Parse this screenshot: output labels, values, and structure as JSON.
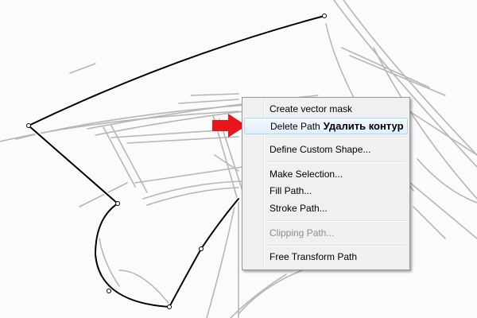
{
  "context_menu": {
    "items": [
      {
        "label": "Create vector mask",
        "state": "normal"
      },
      {
        "label": "Delete Path",
        "annotation": "Удалить контур",
        "state": "highlighted"
      },
      {
        "label": "Define Custom Shape...",
        "state": "normal"
      },
      {
        "label": "Make Selection...",
        "state": "normal"
      },
      {
        "label": "Fill Path...",
        "state": "normal"
      },
      {
        "label": "Stroke Path...",
        "state": "normal"
      },
      {
        "label": "Clipping Path...",
        "state": "disabled"
      },
      {
        "label": "Free Transform Path",
        "state": "normal"
      }
    ]
  },
  "colors": {
    "arrow": "#e8161b",
    "path_stroke": "#000000",
    "sketch": "#b4b4b4",
    "highlight_border": "#a8d8f8"
  },
  "icons": {
    "pointer_arrow": "red-arrow-icon"
  }
}
